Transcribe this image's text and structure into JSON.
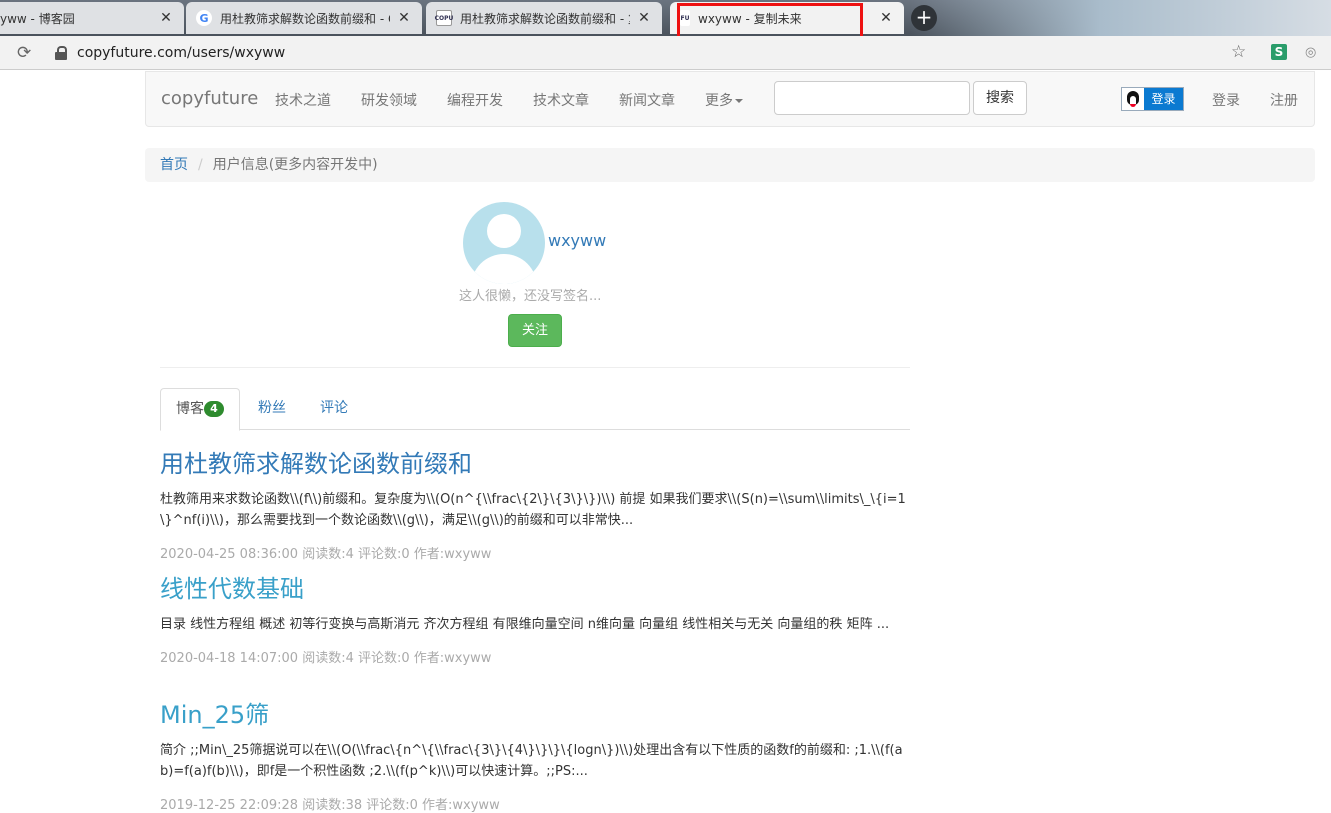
{
  "browser": {
    "tabs": [
      {
        "title": "yww - 博客园",
        "favicon": ""
      },
      {
        "title": "用杜教筛求解数论函数前缀和 - G",
        "favicon": "G"
      },
      {
        "title": "用杜教筛求解数论函数前缀和 - 复",
        "favicon": "COPU"
      },
      {
        "title": "wxyww - 复制未来",
        "favicon": "FU"
      }
    ],
    "address": "copyfuture.com/users/wxyww"
  },
  "navbar": {
    "brand": "copyfuture",
    "links": [
      "技术之道",
      "研发领域",
      "编程开发",
      "技术文章",
      "新闻文章"
    ],
    "more": "更多",
    "search_button": "搜索",
    "qq_login": "登录",
    "login": "登录",
    "register": "注册"
  },
  "breadcrumb": {
    "home": "首页",
    "current": "用户信息(更多内容开发中)"
  },
  "profile": {
    "username": "wxyww",
    "signature": "这人很懒，还没写签名...",
    "follow": "关注"
  },
  "tabs": {
    "blog": "博客",
    "blog_count": "4",
    "fans": "粉丝",
    "comments": "评论"
  },
  "posts": [
    {
      "title": "用杜教筛求解数论函数前缀和",
      "excerpt": "杜教筛用来求数论函数\\\\(f\\\\)前缀和。复杂度为\\\\(O(n^{\\\\frac\\{2\\}\\{3\\}\\})\\\\) 前提 如果我们要求\\\\(S(n)=\\\\sum\\\\limits\\_\\{i=1\\}^nf(i)\\\\)，那么需要找到一个数论函数\\\\(g\\\\)，满足\\\\(g\\\\)的前缀和可以非常快...",
      "meta": "2020-04-25 08:36:00 阅读数:4 评论数:0 作者:wxyww"
    },
    {
      "title": "线性代数基础",
      "excerpt": "目录 线性方程组 概述 初等行变换与高斯消元 齐次方程组 有限维向量空间 n维向量 向量组 线性相关与无关 向量组的秩 矩阵 ...",
      "meta": "2020-04-18 14:07:00 阅读数:4 评论数:0 作者:wxyww"
    },
    {
      "title": "Min_25筛",
      "excerpt": "简介 ;;Min\\_25筛据说可以在\\\\(O(\\\\frac\\{n^\\{\\\\frac\\{3\\}\\{4\\}\\}\\}\\{logn\\})\\\\)处理出含有以下性质的函数f的前缀和: ;1.\\\\(f(ab)=f(a)f(b)\\\\)，即f是一个积性函数 ;2.\\\\(f(p^k)\\\\)可以快速计算。;;PS:...",
      "meta": "2019-12-25 22:09:28 阅读数:38 评论数:0 作者:wxyww"
    }
  ]
}
